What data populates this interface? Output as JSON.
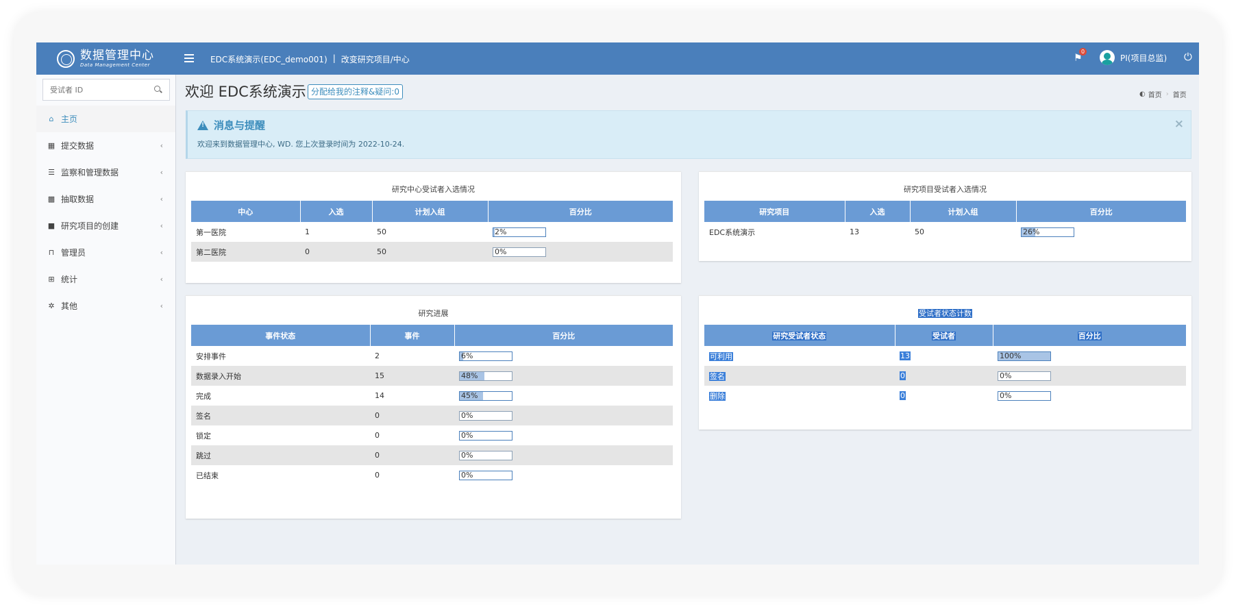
{
  "header": {
    "logo_main": "数据管理中心",
    "logo_sub": "Data Management Center",
    "study_name": "EDC系统演示(EDC_demo001)",
    "separator": "|",
    "change_study": "改变研究项目/中心",
    "notification_count": "0",
    "user_name": "PI(项目总监)"
  },
  "sidebar": {
    "search_placeholder": "受试者 ID",
    "items": [
      {
        "label": "主页",
        "icon": "home-icon"
      },
      {
        "label": "提交数据",
        "icon": "grid-icon"
      },
      {
        "label": "监察和管理数据",
        "icon": "list-icon"
      },
      {
        "label": "抽取数据",
        "icon": "th-icon"
      },
      {
        "label": "研究项目的创建",
        "icon": "folder-icon"
      },
      {
        "label": "管理员",
        "icon": "unlock-icon"
      },
      {
        "label": "统计",
        "icon": "table-icon"
      },
      {
        "label": "其他",
        "icon": "gear-icon"
      }
    ]
  },
  "content": {
    "title": "欢迎 EDC系统演示",
    "assign_button": "分配给我的注释&疑问:0",
    "breadcrumb": [
      "首页",
      "首页"
    ]
  },
  "alert": {
    "title": "消息与提醒",
    "message": "欢迎来到数据管理中心, WD. 您上次登录时间为 2022-10-24.",
    "close": "×"
  },
  "site_enrollment": {
    "title": "研究中心受试者入选情况",
    "headers": [
      "中心",
      "入选",
      "计划入组",
      "百分比"
    ],
    "rows": [
      {
        "name": "第一医院",
        "enrolled": "1",
        "planned": "50",
        "pct": "2%",
        "fill": 0.02
      },
      {
        "name": "第二医院",
        "enrolled": "0",
        "planned": "50",
        "pct": "0%",
        "fill": 0
      }
    ]
  },
  "study_enrollment": {
    "title": "研究项目受试者入选情况",
    "headers": [
      "研究项目",
      "入选",
      "计划入组",
      "百分比"
    ],
    "rows": [
      {
        "name": "EDC系统演示",
        "enrolled": "13",
        "planned": "50",
        "pct": "26%",
        "fill": 0.26
      }
    ]
  },
  "study_progress": {
    "title": "研究进展",
    "headers": [
      "事件状态",
      "事件",
      "百分比"
    ],
    "rows": [
      {
        "status": "安排事件",
        "count": "2",
        "pct": "6%",
        "fill": 0.06
      },
      {
        "status": "数据录入开始",
        "count": "15",
        "pct": "48%",
        "fill": 0.48
      },
      {
        "status": "完成",
        "count": "14",
        "pct": "45%",
        "fill": 0.45
      },
      {
        "status": "签名",
        "count": "0",
        "pct": "0%",
        "fill": 0
      },
      {
        "status": "锁定",
        "count": "0",
        "pct": "0%",
        "fill": 0
      },
      {
        "status": "跳过",
        "count": "0",
        "pct": "0%",
        "fill": 0
      },
      {
        "status": "已结束",
        "count": "0",
        "pct": "0%",
        "fill": 0
      }
    ]
  },
  "subject_status": {
    "title": "受试者状态计数",
    "headers": [
      "研究受试者状态",
      "受试者",
      "百分比"
    ],
    "rows": [
      {
        "status": "可利用",
        "count": "13",
        "pct": "100%",
        "fill": 1.0
      },
      {
        "status": "签名",
        "count": "0",
        "pct": "0%",
        "fill": 0
      },
      {
        "status": "删除",
        "count": "0",
        "pct": "0%",
        "fill": 0
      }
    ]
  },
  "colors": {
    "header_bg": "#4a7fbb",
    "table_header_bg": "#6a9bd5",
    "alert_bg": "#d9edf7",
    "accent": "#3c8dbc",
    "selection": "#3b7fd9"
  }
}
